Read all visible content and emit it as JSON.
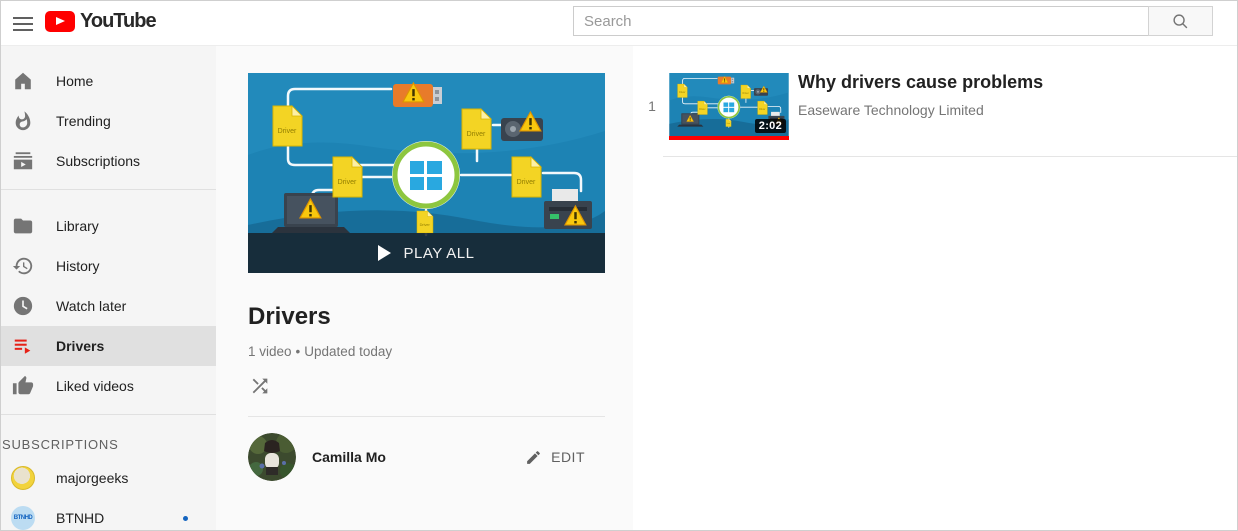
{
  "header": {
    "logo_text": "YouTube",
    "search_placeholder": "Search"
  },
  "sidebar": {
    "main_items": [
      {
        "icon": "home-icon",
        "label": "Home"
      },
      {
        "icon": "trending-icon",
        "label": "Trending"
      },
      {
        "icon": "subscriptions-icon",
        "label": "Subscriptions"
      }
    ],
    "library_items": [
      {
        "icon": "library-icon",
        "label": "Library"
      },
      {
        "icon": "history-icon",
        "label": "History"
      },
      {
        "icon": "watch-later-icon",
        "label": "Watch later"
      },
      {
        "icon": "playlist-icon",
        "label": "Drivers",
        "active": true
      },
      {
        "icon": "liked-icon",
        "label": "Liked videos"
      }
    ],
    "subscriptions_label": "SUBSCRIPTIONS",
    "subscriptions": [
      {
        "label": "majorgeeks",
        "avatar_text": "",
        "new_content": false
      },
      {
        "label": "BTNHD",
        "avatar_text": "BTNHD",
        "new_content": true
      }
    ]
  },
  "playlist": {
    "title": "Drivers",
    "video_count": "1 video",
    "separator": "•",
    "updated": "Updated today",
    "play_all_label": "PLAY ALL",
    "owner_name": "Camilla Mo",
    "edit_label": "EDIT"
  },
  "videos": [
    {
      "index": "1",
      "title": "Why drivers cause problems",
      "channel": "Easeware Technology Limited",
      "duration": "2:02",
      "progress_percent": 100
    }
  ],
  "colors": {
    "brand_red": "#ff0000",
    "sidebar_bg": "#f5f5f5",
    "selected_row_bg": "#e0e0e0",
    "panel_bg": "#fafafa",
    "progress_red": "#ff0000",
    "new_dot_blue": "#1565c0",
    "thumbnail_blue": "#1d83b4"
  }
}
